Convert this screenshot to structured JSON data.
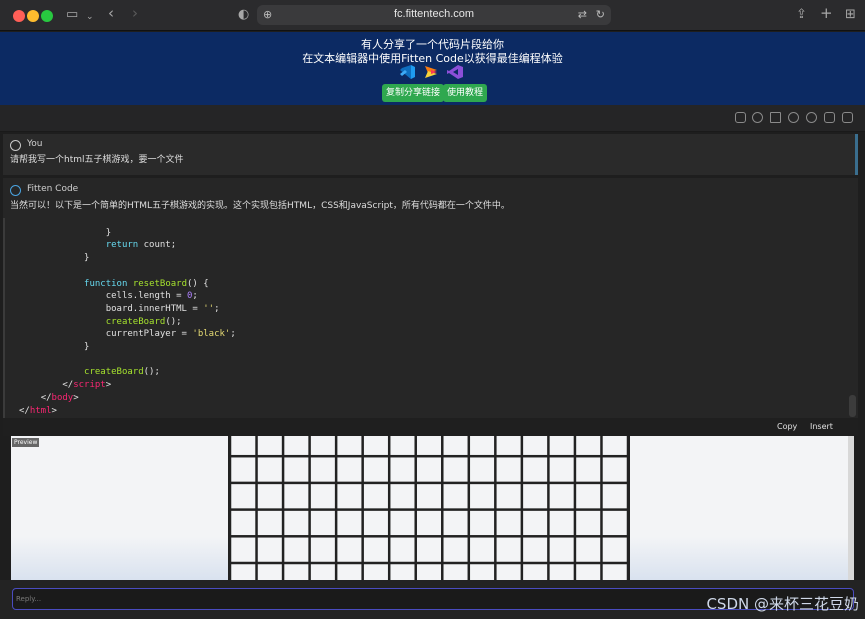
{
  "browser": {
    "url": "fc.fittentech.com"
  },
  "banner": {
    "line1": "有人分享了一个代码片段给你",
    "line2": "在文本编辑器中使用Fitten Code以获得最佳编程体验",
    "copy_link_label": "复制分享链接",
    "tutorial_label": "使用教程",
    "colors": {
      "background": "#0c2a63",
      "button": "#2fa84f"
    }
  },
  "user_message": {
    "author": "You",
    "text": "请帮我写一个html五子棋游戏，要一个文件"
  },
  "ai_message": {
    "author": "Fitten Code",
    "text": "当然可以！以下是一个简单的HTML五子棋游戏的实现。这个实现包括HTML，CSS和JavaScript，所有代码都在一个文件中。"
  },
  "code_lines": [
    {
      "indent": 16,
      "tokens": [
        {
          "t": "}",
          "c": ""
        }
      ]
    },
    {
      "indent": 16,
      "tokens": [
        {
          "t": "return",
          "c": "kw"
        },
        {
          "t": " count;",
          "c": ""
        }
      ]
    },
    {
      "indent": 12,
      "tokens": [
        {
          "t": "}",
          "c": ""
        }
      ]
    },
    {
      "indent": 0,
      "tokens": []
    },
    {
      "indent": 12,
      "tokens": [
        {
          "t": "function",
          "c": "kw"
        },
        {
          "t": " ",
          "c": ""
        },
        {
          "t": "resetBoard",
          "c": "fn"
        },
        {
          "t": "() {",
          "c": ""
        }
      ]
    },
    {
      "indent": 16,
      "tokens": [
        {
          "t": "cells.length = ",
          "c": ""
        },
        {
          "t": "0",
          "c": "num"
        },
        {
          "t": ";",
          "c": ""
        }
      ]
    },
    {
      "indent": 16,
      "tokens": [
        {
          "t": "board.innerHTML = ",
          "c": ""
        },
        {
          "t": "''",
          "c": "str"
        },
        {
          "t": ";",
          "c": ""
        }
      ]
    },
    {
      "indent": 16,
      "tokens": [
        {
          "t": "createBoard",
          "c": "fn"
        },
        {
          "t": "();",
          "c": ""
        }
      ]
    },
    {
      "indent": 16,
      "tokens": [
        {
          "t": "currentPlayer = ",
          "c": ""
        },
        {
          "t": "'black'",
          "c": "str"
        },
        {
          "t": ";",
          "c": ""
        }
      ]
    },
    {
      "indent": 12,
      "tokens": [
        {
          "t": "}",
          "c": ""
        }
      ]
    },
    {
      "indent": 0,
      "tokens": []
    },
    {
      "indent": 12,
      "tokens": [
        {
          "t": "createBoard",
          "c": "fn"
        },
        {
          "t": "();",
          "c": ""
        }
      ]
    },
    {
      "indent": 8,
      "tokens": [
        {
          "t": "</",
          "c": ""
        },
        {
          "t": "script",
          "c": "tag"
        },
        {
          "t": ">",
          "c": ""
        }
      ]
    },
    {
      "indent": 4,
      "tokens": [
        {
          "t": "</",
          "c": ""
        },
        {
          "t": "body",
          "c": "tag"
        },
        {
          "t": ">",
          "c": ""
        }
      ]
    },
    {
      "indent": 0,
      "tokens": [
        {
          "t": "</",
          "c": ""
        },
        {
          "t": "html",
          "c": "tag"
        },
        {
          "t": ">",
          "c": ""
        }
      ]
    }
  ],
  "code_actions": {
    "copy": "Copy",
    "insert": "Insert"
  },
  "preview": {
    "label": "Preview",
    "board_columns": 15,
    "board_rows_visible": 6
  },
  "reply": {
    "placeholder": "Reply..."
  },
  "watermark": "CSDN @来杯三花豆奶"
}
